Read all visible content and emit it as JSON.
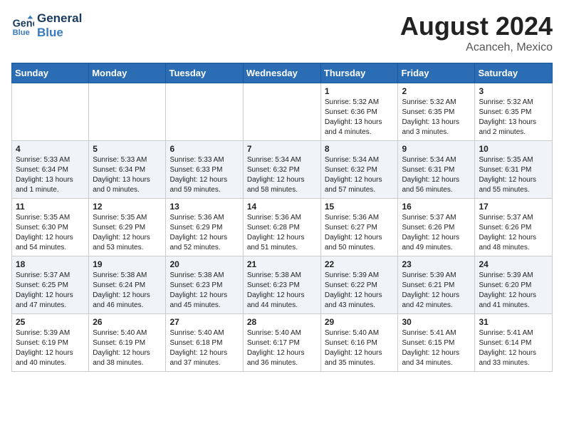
{
  "header": {
    "logo_line1": "General",
    "logo_line2": "Blue",
    "title": "August 2024",
    "subtitle": "Acanceh, Mexico"
  },
  "days_of_week": [
    "Sunday",
    "Monday",
    "Tuesday",
    "Wednesday",
    "Thursday",
    "Friday",
    "Saturday"
  ],
  "weeks": [
    {
      "days": [
        {
          "num": "",
          "info": ""
        },
        {
          "num": "",
          "info": ""
        },
        {
          "num": "",
          "info": ""
        },
        {
          "num": "",
          "info": ""
        },
        {
          "num": "1",
          "info": "Sunrise: 5:32 AM\nSunset: 6:36 PM\nDaylight: 13 hours\nand 4 minutes."
        },
        {
          "num": "2",
          "info": "Sunrise: 5:32 AM\nSunset: 6:35 PM\nDaylight: 13 hours\nand 3 minutes."
        },
        {
          "num": "3",
          "info": "Sunrise: 5:32 AM\nSunset: 6:35 PM\nDaylight: 13 hours\nand 2 minutes."
        }
      ]
    },
    {
      "days": [
        {
          "num": "4",
          "info": "Sunrise: 5:33 AM\nSunset: 6:34 PM\nDaylight: 13 hours\nand 1 minute."
        },
        {
          "num": "5",
          "info": "Sunrise: 5:33 AM\nSunset: 6:34 PM\nDaylight: 13 hours\nand 0 minutes."
        },
        {
          "num": "6",
          "info": "Sunrise: 5:33 AM\nSunset: 6:33 PM\nDaylight: 12 hours\nand 59 minutes."
        },
        {
          "num": "7",
          "info": "Sunrise: 5:34 AM\nSunset: 6:32 PM\nDaylight: 12 hours\nand 58 minutes."
        },
        {
          "num": "8",
          "info": "Sunrise: 5:34 AM\nSunset: 6:32 PM\nDaylight: 12 hours\nand 57 minutes."
        },
        {
          "num": "9",
          "info": "Sunrise: 5:34 AM\nSunset: 6:31 PM\nDaylight: 12 hours\nand 56 minutes."
        },
        {
          "num": "10",
          "info": "Sunrise: 5:35 AM\nSunset: 6:31 PM\nDaylight: 12 hours\nand 55 minutes."
        }
      ]
    },
    {
      "days": [
        {
          "num": "11",
          "info": "Sunrise: 5:35 AM\nSunset: 6:30 PM\nDaylight: 12 hours\nand 54 minutes."
        },
        {
          "num": "12",
          "info": "Sunrise: 5:35 AM\nSunset: 6:29 PM\nDaylight: 12 hours\nand 53 minutes."
        },
        {
          "num": "13",
          "info": "Sunrise: 5:36 AM\nSunset: 6:29 PM\nDaylight: 12 hours\nand 52 minutes."
        },
        {
          "num": "14",
          "info": "Sunrise: 5:36 AM\nSunset: 6:28 PM\nDaylight: 12 hours\nand 51 minutes."
        },
        {
          "num": "15",
          "info": "Sunrise: 5:36 AM\nSunset: 6:27 PM\nDaylight: 12 hours\nand 50 minutes."
        },
        {
          "num": "16",
          "info": "Sunrise: 5:37 AM\nSunset: 6:26 PM\nDaylight: 12 hours\nand 49 minutes."
        },
        {
          "num": "17",
          "info": "Sunrise: 5:37 AM\nSunset: 6:26 PM\nDaylight: 12 hours\nand 48 minutes."
        }
      ]
    },
    {
      "days": [
        {
          "num": "18",
          "info": "Sunrise: 5:37 AM\nSunset: 6:25 PM\nDaylight: 12 hours\nand 47 minutes."
        },
        {
          "num": "19",
          "info": "Sunrise: 5:38 AM\nSunset: 6:24 PM\nDaylight: 12 hours\nand 46 minutes."
        },
        {
          "num": "20",
          "info": "Sunrise: 5:38 AM\nSunset: 6:23 PM\nDaylight: 12 hours\nand 45 minutes."
        },
        {
          "num": "21",
          "info": "Sunrise: 5:38 AM\nSunset: 6:23 PM\nDaylight: 12 hours\nand 44 minutes."
        },
        {
          "num": "22",
          "info": "Sunrise: 5:39 AM\nSunset: 6:22 PM\nDaylight: 12 hours\nand 43 minutes."
        },
        {
          "num": "23",
          "info": "Sunrise: 5:39 AM\nSunset: 6:21 PM\nDaylight: 12 hours\nand 42 minutes."
        },
        {
          "num": "24",
          "info": "Sunrise: 5:39 AM\nSunset: 6:20 PM\nDaylight: 12 hours\nand 41 minutes."
        }
      ]
    },
    {
      "days": [
        {
          "num": "25",
          "info": "Sunrise: 5:39 AM\nSunset: 6:19 PM\nDaylight: 12 hours\nand 40 minutes."
        },
        {
          "num": "26",
          "info": "Sunrise: 5:40 AM\nSunset: 6:19 PM\nDaylight: 12 hours\nand 38 minutes."
        },
        {
          "num": "27",
          "info": "Sunrise: 5:40 AM\nSunset: 6:18 PM\nDaylight: 12 hours\nand 37 minutes."
        },
        {
          "num": "28",
          "info": "Sunrise: 5:40 AM\nSunset: 6:17 PM\nDaylight: 12 hours\nand 36 minutes."
        },
        {
          "num": "29",
          "info": "Sunrise: 5:40 AM\nSunset: 6:16 PM\nDaylight: 12 hours\nand 35 minutes."
        },
        {
          "num": "30",
          "info": "Sunrise: 5:41 AM\nSunset: 6:15 PM\nDaylight: 12 hours\nand 34 minutes."
        },
        {
          "num": "31",
          "info": "Sunrise: 5:41 AM\nSunset: 6:14 PM\nDaylight: 12 hours\nand 33 minutes."
        }
      ]
    }
  ]
}
